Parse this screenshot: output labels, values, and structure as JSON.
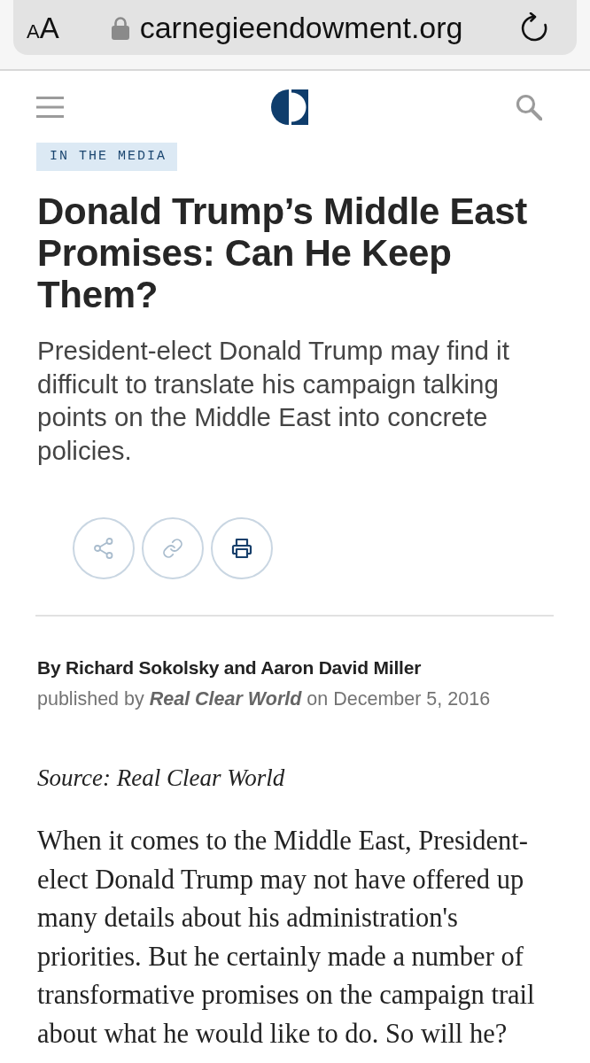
{
  "browser": {
    "text_size_button": {
      "small": "A",
      "large": "A"
    },
    "url": "carnegieendowment.org"
  },
  "tag": "IN THE MEDIA",
  "title": "Donald Trump’s Middle East Promises: Can He Keep Them?",
  "summary": "President-elect Donald Trump may find it difficult to translate his campaign talking points on the Middle East into concrete policies.",
  "share_buttons": [
    {
      "kind": "share",
      "highlighted": false
    },
    {
      "kind": "link",
      "highlighted": false
    },
    {
      "kind": "print",
      "highlighted": true
    }
  ],
  "byline": "By Richard Sokolsky and Aaron David Miller",
  "published": "published by *Real Clear World* on December 5, 2016",
  "source": "Source: Real Clear World",
  "paragraphs": [
    "When it comes to the Middle East, President-elect Donald Trump may not have offered up many details about his administration's priorities. But he certainly made a number of transformative promises on the campaign trail about what he would like to do. So will he?"
  ]
}
